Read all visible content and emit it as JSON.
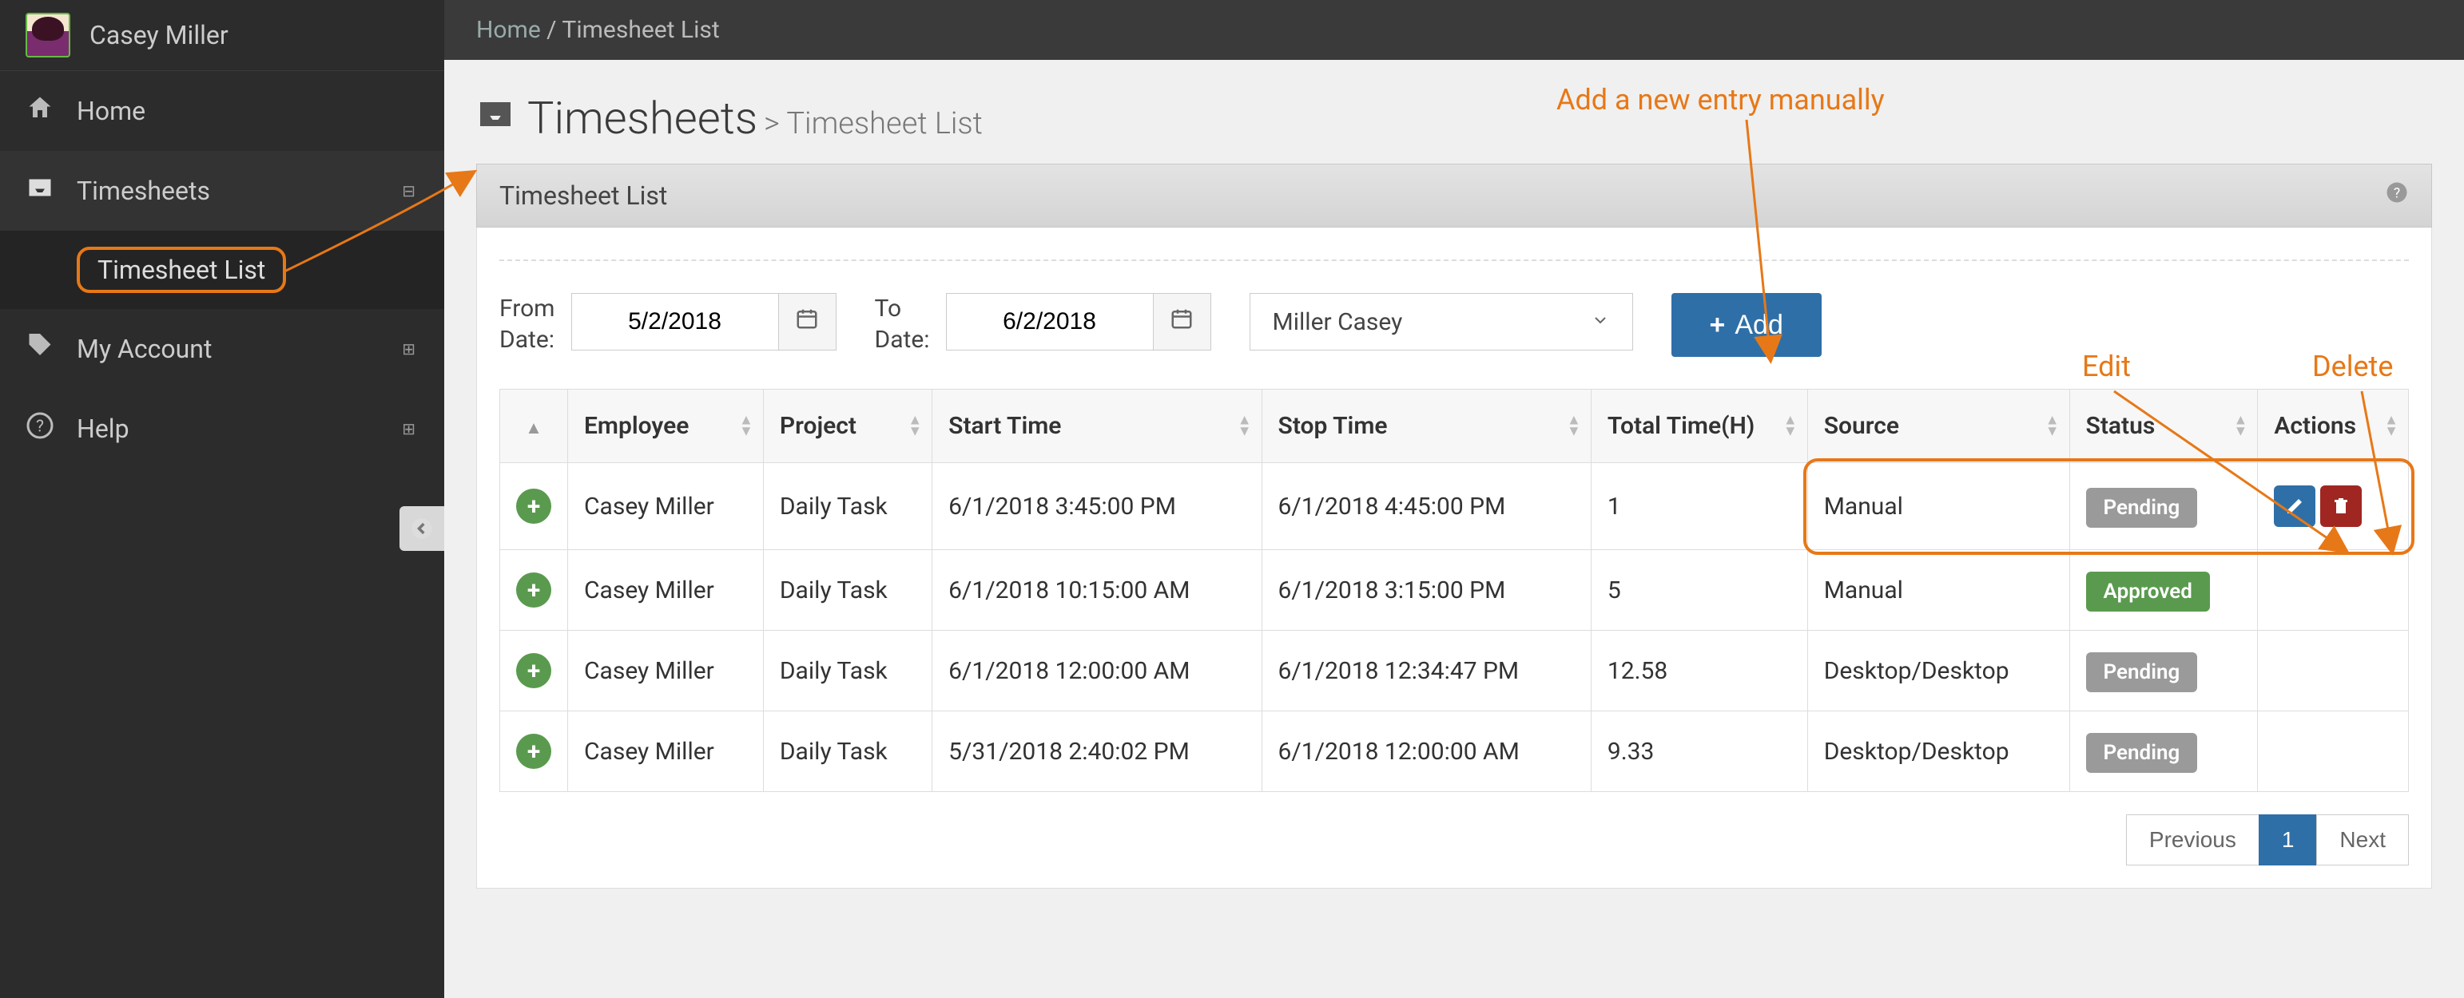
{
  "user": {
    "name": "Casey Miller"
  },
  "sidebar": {
    "items": [
      {
        "label": "Home",
        "icon": "home-icon"
      },
      {
        "label": "Timesheets",
        "icon": "inbox-icon",
        "expanded": true,
        "badge": "⊟"
      },
      {
        "label": "My Account",
        "icon": "tag-icon",
        "badge": "⊞"
      },
      {
        "label": "Help",
        "icon": "help-icon",
        "badge": "⊞"
      }
    ],
    "sub": {
      "timesheet_list": "Timesheet List"
    }
  },
  "breadcrumb": {
    "home": "Home",
    "sep": " / ",
    "current": "Timesheet List"
  },
  "page": {
    "title": "Timesheets",
    "sub_prefix": ">",
    "sub": "Timesheet List"
  },
  "panel": {
    "title": "Timesheet List"
  },
  "filters": {
    "from_label": "From\nDate:",
    "from_value": "5/2/2018",
    "to_label": "To\nDate:",
    "to_value": "6/2/2018",
    "employee": "Miller Casey",
    "add_label": "Add"
  },
  "table": {
    "columns": [
      "",
      "Employee",
      "Project",
      "Start Time",
      "Stop Time",
      "Total Time(H)",
      "Source",
      "Status",
      "Actions"
    ],
    "rows": [
      {
        "employee": "Casey Miller",
        "project": "Daily Task",
        "start": "6/1/2018 3:45:00 PM",
        "stop": "6/1/2018 4:45:00 PM",
        "total": "1",
        "source": "Manual",
        "status": "Pending",
        "actions": true,
        "highlight": true
      },
      {
        "employee": "Casey Miller",
        "project": "Daily Task",
        "start": "6/1/2018 10:15:00 AM",
        "stop": "6/1/2018 3:15:00 PM",
        "total": "5",
        "source": "Manual",
        "status": "Approved"
      },
      {
        "employee": "Casey Miller",
        "project": "Daily Task",
        "start": "6/1/2018 12:00:00 AM",
        "stop": "6/1/2018 12:34:47 PM",
        "total": "12.58",
        "source": "Desktop/Desktop",
        "status": "Pending"
      },
      {
        "employee": "Casey Miller",
        "project": "Daily Task",
        "start": "5/31/2018 2:40:02 PM",
        "stop": "6/1/2018 12:00:00 AM",
        "total": "9.33",
        "source": "Desktop/Desktop",
        "status": "Pending"
      }
    ]
  },
  "pager": {
    "prev": "Previous",
    "page": "1",
    "next": "Next"
  },
  "annotations": {
    "add": "Add a new entry manually",
    "edit": "Edit",
    "delete": "Delete"
  }
}
